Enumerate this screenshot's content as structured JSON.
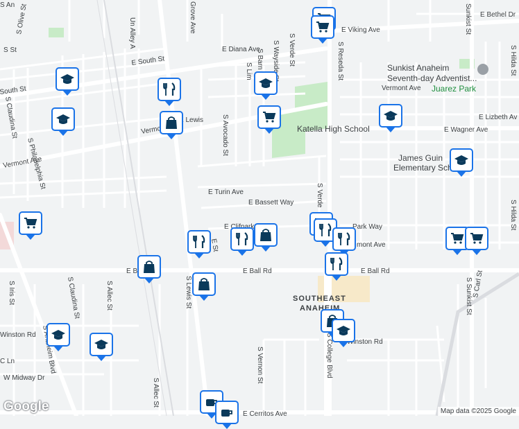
{
  "map": {
    "logo": "Google",
    "attribution": "Map data ©2025 Google",
    "colors": {
      "pin_border": "#1a73e8",
      "pin_icon": "#0b3a5b",
      "road": "#ffffff",
      "park": "#c8ebc7",
      "land": "#f1f3f4"
    }
  },
  "labels": {
    "e_south_st": "E South St",
    "south_st_left": "South St",
    "e_diana_ave": "E Diana Ave",
    "vermont_ave_upper": "Vermont",
    "vermont_ave_left": "Vermont Ave",
    "vermont_ave_right": "Vermont Ave",
    "e_viking_ave": "E Viking Ave",
    "e_bethel_dr": "E Bethel Dr",
    "e_lizbeth_ave": "E Lizbeth Av",
    "e_wagner_ave": "E Wagner Ave",
    "e_turin_ave": "E Turin Ave",
    "e_bassett_way": "E Bassett Way",
    "e_clifpark": "E Clifpark",
    "park_way": "Park Way",
    "mont_ave": "mont Ave",
    "e_ball_rd_left": "E Ball Rd",
    "e_ball_rd_right": "E Ball Rd",
    "winston_rd_left": "Winston Rd",
    "winston_rd_right": "Winston Rd",
    "w_midway_dr": "W Midway Dr",
    "e_cerritos_ave": "E Cerritos Ave",
    "s_olive_st": "S Olive St",
    "s_philadelphia_st": "S Philadelphia St",
    "s_claudina_st_left": "S Claudina St",
    "s_claudina_st_lower": "S Claudina St",
    "s_iris_st": "S Iris St",
    "s_allec_st": "S Allec St",
    "s_allec_st_lower": "S Allec St",
    "s_lewis_st": "S Lewis St",
    "s_vernon_st": "S Vernon St",
    "s_avocado_st": "S Avocado St",
    "s_verde_st_top": "S Verde St",
    "s_verde_st_mid": "S Verde",
    "s_reseda_st": "S Reseda St",
    "s_sunkist_st_top": "Sunkist St",
    "s_sunkist_st_bottom": "S Sunkist St",
    "s_hilda_st_top": "S Hilda St",
    "s_hilda_st_mid": "S Hilda St",
    "s_carl_st": "S Carl St",
    "s_wayside_st": "S Wayside St",
    "s_barn": "S Barn",
    "s_lime": "S Lim",
    "grove_ave": "Grove Ave",
    "un_alley": "Un Alley A",
    "college_blvd": "S College Blvd",
    "anaheim_blvd": "S Anaheim Blvd",
    "e_st": "E St",
    "e_lewis": "E Lewis",
    "c_ln": "C Ln",
    "s_st": "S St",
    "s_anaheim_top": "S An",
    "sunkist_church": "Sunkist Anaheim",
    "sunkist_church_2": "Seventh-day Adventist...",
    "juarez_park": "Juarez Park",
    "katella_high": "Katella High School",
    "james_guinn": "James Guin",
    "james_guinn_2": "Elementary School",
    "southeast": "SOUTHEAST",
    "anaheim": "ANAHEIM"
  },
  "pins": [
    {
      "type": "grocery-icon"
    },
    {
      "type": "grocery-icon"
    },
    {
      "type": "school-icon"
    },
    {
      "type": "restaurant-icon"
    },
    {
      "type": "school-icon"
    },
    {
      "type": "grocery-icon"
    },
    {
      "type": "school-icon"
    },
    {
      "type": "shopping-icon"
    },
    {
      "type": "school-icon"
    },
    {
      "type": "school-icon"
    },
    {
      "type": "grocery-icon"
    },
    {
      "type": "restaurant-icon"
    },
    {
      "type": "restaurant-icon"
    },
    {
      "type": "shopping-icon"
    },
    {
      "type": "grocery-icon"
    },
    {
      "type": "restaurant-icon"
    },
    {
      "type": "restaurant-icon"
    },
    {
      "type": "grocery-icon"
    },
    {
      "type": "grocery-icon"
    },
    {
      "type": "restaurant-icon"
    },
    {
      "type": "shopping-icon"
    },
    {
      "type": "shopping-icon"
    },
    {
      "type": "shopping-icon"
    },
    {
      "type": "school-icon"
    },
    {
      "type": "school-icon"
    },
    {
      "type": "school-icon"
    },
    {
      "type": "cafe-icon"
    },
    {
      "type": "cafe-icon"
    }
  ]
}
